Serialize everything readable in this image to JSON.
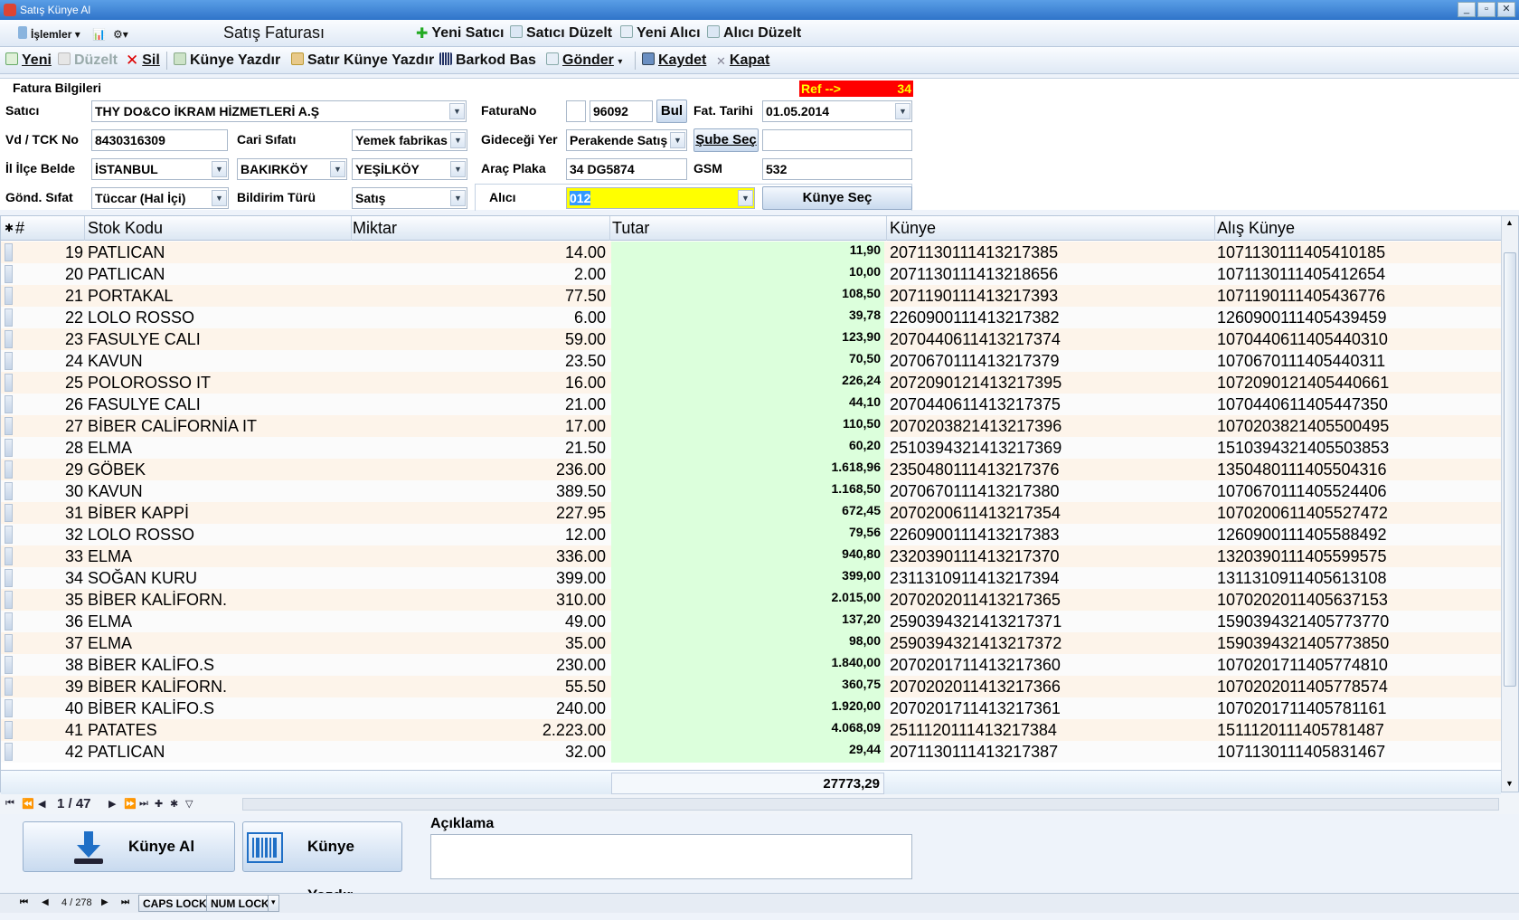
{
  "window": {
    "title": "Satış Künye Al"
  },
  "toolbar1": {
    "islemler": "İşlemler",
    "form_title": "Satış Faturası",
    "yeni_satici": "Yeni Satıcı",
    "satici_duzelt": "Satıcı Düzelt",
    "yeni_alici": "Yeni Alıcı",
    "alici_duzelt": "Alıcı Düzelt"
  },
  "toolbar2": {
    "yeni": "Yeni",
    "duzelt": "Düzelt",
    "sil": "Sil",
    "kunye_yazdir": "Künye Yazdır",
    "satir_kunye_yazdir": "Satır Künye Yazdır",
    "barkod_bas": "Barkod Bas",
    "gonder": "Gönder",
    "kaydet": "Kaydet",
    "kapat": "Kapat"
  },
  "form": {
    "section_title": "Fatura Bilgileri",
    "ref_label": "Ref -->",
    "ref_value": "34",
    "satici_label": "Satıcı",
    "satici": "THY DO&CO İKRAM HİZMETLERİ A.Ş",
    "faturano_label": "FaturaNo",
    "faturano_prefix": "",
    "faturano": "96092",
    "bul": "Bul",
    "fat_tarihi_label": "Fat. Tarihi",
    "fat_tarihi": "01.05.2014",
    "vd_label": "Vd / TCK No",
    "vd": "8430316309",
    "cari_label": "Cari Sıfatı",
    "cari": "Yemek fabrikas",
    "gidecegi_label": "Gideceği Yer",
    "gidecegi": "Perakende Satış",
    "sube_sec": "Şube Seç",
    "sube_value": "",
    "il_label": "İl İlçe Belde",
    "il": "İSTANBUL",
    "ilce": "BAKIRKÖY",
    "belde": "YEŞİLKÖY",
    "plaka_label": "Araç Plaka",
    "plaka": "34 DG5874",
    "gsm_label": "GSM",
    "gsm": "532",
    "gond_label": "Gönd. Sıfat",
    "gond": "Tüccar (Hal İçi)",
    "bildirim_label": "Bildirim Türü",
    "bildirim": "Satış",
    "alici_label": "Alıcı",
    "alici": "012",
    "kunye_sec": "Künye Seç"
  },
  "grid": {
    "columns": {
      "num": "#",
      "stok": "Stok Kodu",
      "miktar": "Miktar",
      "tutar": "Tutar",
      "kunye": "Künye",
      "alis": "Alış Künye"
    },
    "rows": [
      {
        "no": "19",
        "stok": "PATLICAN",
        "miktar": "14.00",
        "tutar": "11,90",
        "kunye": "2071130111413217385",
        "alis": "1071130111405410185"
      },
      {
        "no": "20",
        "stok": "PATLICAN",
        "miktar": "2.00",
        "tutar": "10,00",
        "kunye": "2071130111413218656",
        "alis": "1071130111405412654"
      },
      {
        "no": "21",
        "stok": "PORTAKAL",
        "miktar": "77.50",
        "tutar": "108,50",
        "kunye": "2071190111413217393",
        "alis": "1071190111405436776"
      },
      {
        "no": "22",
        "stok": "LOLO ROSSO",
        "miktar": "6.00",
        "tutar": "39,78",
        "kunye": "2260900111413217382",
        "alis": "1260900111405439459"
      },
      {
        "no": "23",
        "stok": "FASULYE CALI",
        "miktar": "59.00",
        "tutar": "123,90",
        "kunye": "2070440611413217374",
        "alis": "1070440611405440310"
      },
      {
        "no": "24",
        "stok": "KAVUN",
        "miktar": "23.50",
        "tutar": "70,50",
        "kunye": "2070670111413217379",
        "alis": "1070670111405440311"
      },
      {
        "no": "25",
        "stok": "POLOROSSO  IT",
        "miktar": "16.00",
        "tutar": "226,24",
        "kunye": "2072090121413217395",
        "alis": "1072090121405440661"
      },
      {
        "no": "26",
        "stok": "FASULYE CALI",
        "miktar": "21.00",
        "tutar": "44,10",
        "kunye": "2070440611413217375",
        "alis": "1070440611405447350"
      },
      {
        "no": "27",
        "stok": "BİBER CALİFORNİA  IT",
        "miktar": "17.00",
        "tutar": "110,50",
        "kunye": "2070203821413217396",
        "alis": "1070203821405500495"
      },
      {
        "no": "28",
        "stok": "ELMA",
        "miktar": "21.50",
        "tutar": "60,20",
        "kunye": "2510394321413217369",
        "alis": "1510394321405503853"
      },
      {
        "no": "29",
        "stok": "GÖBEK",
        "miktar": "236.00",
        "tutar": "1.618,96",
        "kunye": "2350480111413217376",
        "alis": "1350480111405504316"
      },
      {
        "no": "30",
        "stok": "KAVUN",
        "miktar": "389.50",
        "tutar": "1.168,50",
        "kunye": "2070670111413217380",
        "alis": "1070670111405524406"
      },
      {
        "no": "31",
        "stok": "BİBER KAPPİ",
        "miktar": "227.95",
        "tutar": "672,45",
        "kunye": "2070200611413217354",
        "alis": "1070200611405527472"
      },
      {
        "no": "32",
        "stok": "LOLO ROSSO",
        "miktar": "12.00",
        "tutar": "79,56",
        "kunye": "2260900111413217383",
        "alis": "1260900111405588492"
      },
      {
        "no": "33",
        "stok": "ELMA",
        "miktar": "336.00",
        "tutar": "940,80",
        "kunye": "2320390111413217370",
        "alis": "1320390111405599575"
      },
      {
        "no": "34",
        "stok": "SOĞAN  KURU",
        "miktar": "399.00",
        "tutar": "399,00",
        "kunye": "2311310911413217394",
        "alis": "1311310911405613108"
      },
      {
        "no": "35",
        "stok": "BİBER KALİFORN.",
        "miktar": "310.00",
        "tutar": "2.015,00",
        "kunye": "2070202011413217365",
        "alis": "1070202011405637153"
      },
      {
        "no": "36",
        "stok": "ELMA",
        "miktar": "49.00",
        "tutar": "137,20",
        "kunye": "2590394321413217371",
        "alis": "1590394321405773770"
      },
      {
        "no": "37",
        "stok": "ELMA",
        "miktar": "35.00",
        "tutar": "98,00",
        "kunye": "2590394321413217372",
        "alis": "1590394321405773850"
      },
      {
        "no": "38",
        "stok": "BİBER KALİFO.S",
        "miktar": "230.00",
        "tutar": "1.840,00",
        "kunye": "2070201711413217360",
        "alis": "1070201711405774810"
      },
      {
        "no": "39",
        "stok": "BİBER KALİFORN.",
        "miktar": "55.50",
        "tutar": "360,75",
        "kunye": "2070202011413217366",
        "alis": "1070202011405778574"
      },
      {
        "no": "40",
        "stok": "BİBER KALİFO.S",
        "miktar": "240.00",
        "tutar": "1.920,00",
        "kunye": "2070201711413217361",
        "alis": "1070201711405781161"
      },
      {
        "no": "41",
        "stok": "PATATES",
        "miktar": "2.223.00",
        "tutar": "4.068,09",
        "kunye": "2511120111413217384",
        "alis": "1511120111405781487"
      },
      {
        "no": "42",
        "stok": "PATLICAN",
        "miktar": "32.00",
        "tutar": "29,44",
        "kunye": "2071130111413217387",
        "alis": "1071130111405831467"
      }
    ],
    "total": "27773,29"
  },
  "navigator": {
    "page": "1 / 47"
  },
  "bottom": {
    "kunye_al": "Künye Al",
    "kunye_yazdir": "Künye Yazdır",
    "aciklama_label": "Açıklama"
  },
  "statusbar": {
    "record": "4 / 278",
    "caps": "CAPS LOCK",
    "num": "NUM LOCK"
  }
}
